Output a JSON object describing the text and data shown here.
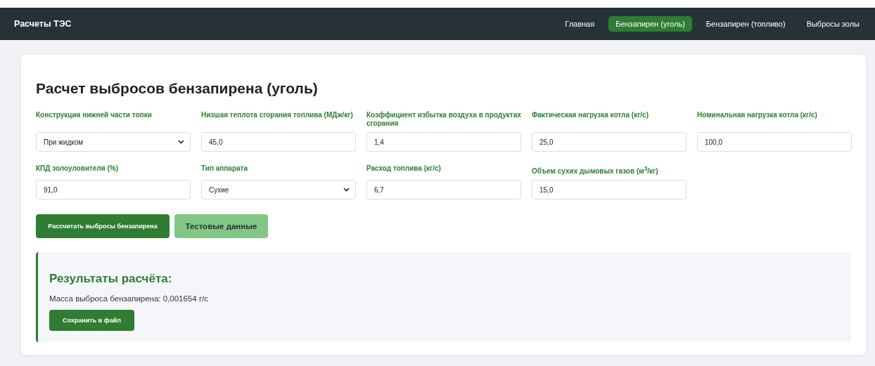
{
  "navbar": {
    "brand": "Расчеты ТЭС",
    "links": [
      {
        "label": "Главная",
        "selected": false
      },
      {
        "label": "Бензапирен (уголь)",
        "selected": true
      },
      {
        "label": "Бензапирен (топливо)",
        "selected": false
      },
      {
        "label": "Выбросы золы",
        "selected": false
      }
    ]
  },
  "form": {
    "title": "Расчет выбросов бензапирена (уголь)",
    "fields": [
      {
        "kind": "select",
        "label": "Конструкция нижней части топки",
        "value": "При жидком"
      },
      {
        "kind": "input",
        "label": "Низшая теплота сгорания топлива (МДж/кг)",
        "value": "45,0"
      },
      {
        "kind": "input",
        "label": "Коэффициент избытка воздуха в продуктах сгорания",
        "value": "1,4"
      },
      {
        "kind": "input",
        "label": "Фактическая нагрузка котла (кг/с)",
        "value": "25,0"
      },
      {
        "kind": "input",
        "label": "Номинальная нагрузка котла (кг/с)",
        "value": "100,0"
      },
      {
        "kind": "input",
        "label": "КПД золоуловителя (%)",
        "value": "91,0"
      },
      {
        "kind": "select",
        "label": "Тип аппарата",
        "value": "Сухие"
      },
      {
        "kind": "input",
        "label": "Расход топлива (кг/с)",
        "value": "6,7"
      },
      {
        "kind": "input",
        "label": "Объем сухих дымовых газов (м$^{3}$/кг)",
        "value": "15,0"
      }
    ],
    "buttons": [
      {
        "kind": "primary",
        "label": "Рассчитать выбросы бензапирена"
      },
      {
        "kind": "secondary",
        "label": "Тестовые данные"
      }
    ]
  },
  "results": {
    "title": "Результаты расчёта:",
    "text": "Масса выброса бензапирена: 0,001654 г/с",
    "button": "Сохранить в файл"
  }
}
